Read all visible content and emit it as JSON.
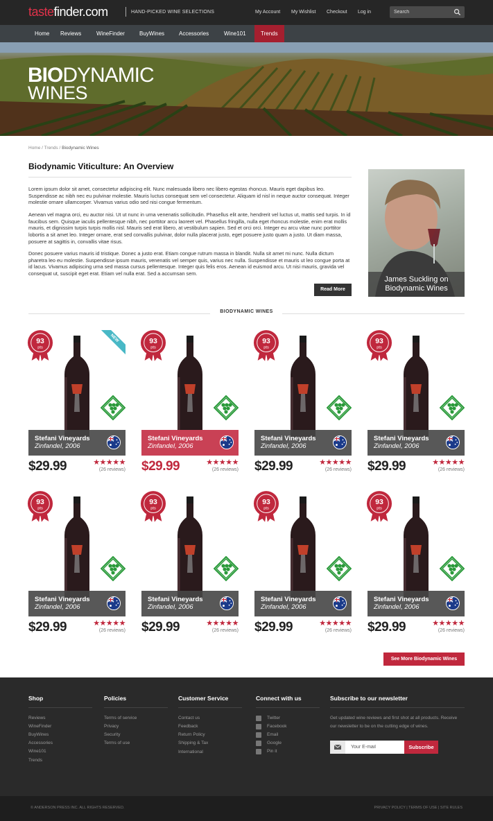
{
  "header": {
    "logo_part1": "taste",
    "logo_part2": "finder.com",
    "tagline": "HAND-PICKED WINE SELECTIONS",
    "links": [
      "My Account",
      "My Wishlist",
      "Checkout",
      "Log in"
    ],
    "search_placeholder": "Search"
  },
  "nav": {
    "items": [
      "Home",
      "Reviews",
      "WineFinder",
      "BuyWines",
      "Accessories",
      "Wine101",
      "Trends"
    ],
    "active": "Trends"
  },
  "hero": {
    "title_bold": "BIO",
    "title_light": "DYNAMIC",
    "title_line2": "WINES"
  },
  "breadcrumb": {
    "home": "Home",
    "sep": "/",
    "trends": "Trends",
    "current": "Biodynamic Wines"
  },
  "article": {
    "title": "Biodynamic Viticulture: An Overview",
    "paragraphs": [
      "Lorem ipsum dolor sit amet, consectetur adipiscing elit. Nunc malesuada libero nec libero egestas rhoncus. Mauris eget dapibus leo. Suspendisse ac nibh nec eu pulvinar molestie. Mauris luctus consequat sem vel consectetur. Aliquam id nisl in neque auctor consequat. Integer molestie ornare ullamcorper. Vivamus varius odio sed nisi congue fermentum.",
      "Aenean vel magna orci, eu auctor nisi. Ut ut nunc in urna venenatis sollicitudin. Phasellus elit ante, hendrerit vel luctus ut, mattis sed turpis. In id faucibus sem. Quisque iaculis pellentesque nibh, nec porttitor arcu laoreet vel. Phasellus fringilla, nulla eget rhoncus molestie, enim erat mollis mauris, et dignissim turpis turpis mollis nisl. Mauris sed erat libero, at vestibulum sapien. Sed et orci orci. Integer eu arcu vitae nunc porttitor lobortis a sit amet leo. Integer ornare, erat sed convallis pulvinar, dolor nulla placerat justo, eget posuere justo quam a justo. Ut diam massa, posuere at sagittis in, convallis vitae risus.",
      "Donec posuere varius mauris id tristique. Donec a justo erat. Etiam congue rutrum massa in blandit. Nulla sit amet mi nunc. Nulla dictum pharetra leo eu molestie. Suspendisse ipsum mauris, venenatis vel semper quis, varius nec nulla. Suspendisse et mauris ut leo congue porta at id lacus. Vivamus adipiscing urna sed massa cursus pellentesque. Integer quis felis eros. Aenean id euismod arcu. Ut nisi mauris, gravida vel consequat ut, suscipit eget erat. Etiam vel nulla erat. Sed a accumsan sem."
    ],
    "read_more": "Read More",
    "portrait_caption_line1": "James Suckling on",
    "portrait_caption_line2": "Biodynamic Wines"
  },
  "section_title": "BIODYNAMIC WINES",
  "products": [
    {
      "vineyard": "Stefani Vineyards",
      "wine": "Zinfandel, 2006",
      "price": "$29.99",
      "points": "93",
      "pts": "pts",
      "stars": "★★★★★",
      "reviews": "(26 reviews)",
      "new": "NEW"
    },
    {
      "vineyard": "Stefani Vineyards",
      "wine": "Zinfandel, 2006",
      "price": "$29.99",
      "points": "93",
      "pts": "pts",
      "stars": "★★★★★",
      "reviews": "(26 reviews)"
    },
    {
      "vineyard": "Stefani Vineyards",
      "wine": "Zinfandel, 2006",
      "price": "$29.99",
      "points": "93",
      "pts": "pts",
      "stars": "★★★★★",
      "reviews": "(26 reviews)"
    },
    {
      "vineyard": "Stefani Vineyards",
      "wine": "Zinfandel, 2006",
      "price": "$29.99",
      "points": "93",
      "pts": "pts",
      "stars": "★★★★★",
      "reviews": "(26 reviews)"
    },
    {
      "vineyard": "Stefani Vineyards",
      "wine": "Zinfandel, 2006",
      "price": "$29.99",
      "points": "93",
      "pts": "pts",
      "stars": "★★★★★",
      "reviews": "(26 reviews)"
    },
    {
      "vineyard": "Stefani Vineyards",
      "wine": "Zinfandel, 2006",
      "price": "$29.99",
      "points": "93",
      "pts": "pts",
      "stars": "★★★★★",
      "reviews": "(26 reviews)"
    },
    {
      "vineyard": "Stefani Vineyards",
      "wine": "Zinfandel, 2006",
      "price": "$29.99",
      "points": "93",
      "pts": "pts",
      "stars": "★★★★★",
      "reviews": "(26 reviews)"
    },
    {
      "vineyard": "Stefani Vineyards",
      "wine": "Zinfandel, 2006",
      "price": "$29.99",
      "points": "93",
      "pts": "pts",
      "stars": "★★★★★",
      "reviews": "(26 reviews)"
    }
  ],
  "see_more": "See More Biodynamic Wines",
  "footer": {
    "shop": {
      "title": "Shop",
      "items": [
        "Reviews",
        "WineFinder",
        "BuyWines",
        "Accessories",
        "Wine101",
        "Trends"
      ]
    },
    "policies": {
      "title": "Policies",
      "items": [
        "Terms of service",
        "Privacy",
        "Security",
        "Terms of use"
      ]
    },
    "service": {
      "title": "Customer Service",
      "items": [
        "Contact us",
        "Feedback",
        "Return Policy",
        "Shipping & Tax",
        "International"
      ]
    },
    "connect": {
      "title": "Connect with us",
      "items": [
        "Twitter",
        "Facebook",
        "Email",
        "Google",
        "Pin it"
      ]
    },
    "newsletter": {
      "title": "Subscribe to our newsletter",
      "text": "Get updated wine reviews and first shot at all products. Receive our newsletter to be on the cutting edge of wines.",
      "placeholder": "Your E-mail",
      "button": "Subscribe"
    },
    "copyright": "© ANDERSON PRESS INC.   ALL RIGHTS RESERVED.",
    "legal": "PRIVACY POLICY | TERMS OF USE | SITE RULES"
  },
  "colors": {
    "accent": "#c0283d",
    "nav_active": "#a51f2f",
    "new_badge": "#49b8c6",
    "dark": "#262626"
  }
}
